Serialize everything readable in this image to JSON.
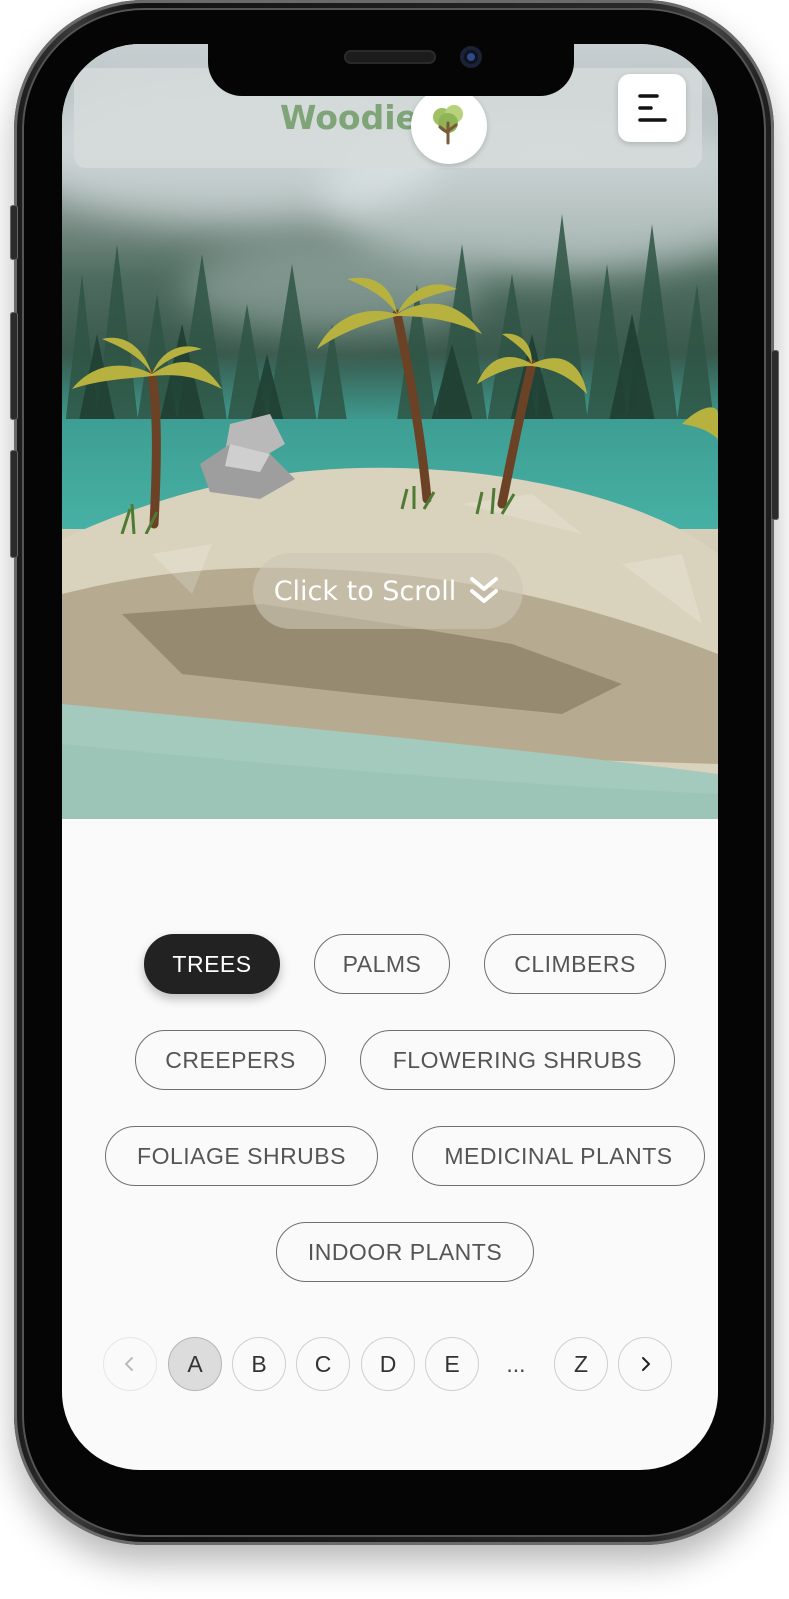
{
  "header": {
    "brand": "Woodie"
  },
  "hero": {
    "scroll_label": "Click to Scroll"
  },
  "categories": [
    {
      "label": "TREES",
      "active": true
    },
    {
      "label": "PALMS",
      "active": false
    },
    {
      "label": "CLIMBERS",
      "active": false
    },
    {
      "label": "CREEPERS",
      "active": false
    },
    {
      "label": "FLOWERING SHRUBS",
      "active": false
    },
    {
      "label": "FOLIAGE SHRUBS",
      "active": false
    },
    {
      "label": "MEDICINAL PLANTS",
      "active": false
    },
    {
      "label": "INDOOR PLANTS",
      "active": false
    }
  ],
  "pagination": {
    "prev": "‹",
    "next": "›",
    "letters": [
      "A",
      "B",
      "C",
      "D",
      "E"
    ],
    "ellipsis": "...",
    "last": "Z",
    "active": "A"
  },
  "colors": {
    "brand_green": "#7ea477",
    "active_chip": "#222222"
  }
}
